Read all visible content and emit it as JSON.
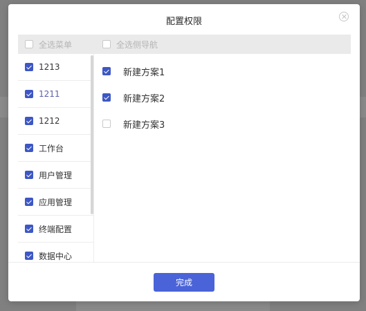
{
  "dialog": {
    "title": "配置权限",
    "close_icon": "close-circle-icon",
    "select_all_menu_label": "全选菜单",
    "select_all_menu_checked": false,
    "select_all_nav_label": "全选侧导航",
    "select_all_nav_checked": false,
    "menu_items": [
      {
        "label": "1213",
        "checked": true,
        "active": false
      },
      {
        "label": "1211",
        "checked": true,
        "active": true
      },
      {
        "label": "1212",
        "checked": true,
        "active": false
      },
      {
        "label": "工作台",
        "checked": true,
        "active": false
      },
      {
        "label": "用户管理",
        "checked": true,
        "active": false
      },
      {
        "label": "应用管理",
        "checked": true,
        "active": false
      },
      {
        "label": "终端配置",
        "checked": true,
        "active": false
      },
      {
        "label": "数据中心",
        "checked": true,
        "active": false
      }
    ],
    "nav_items": [
      {
        "label": "新建方案1",
        "checked": true
      },
      {
        "label": "新建方案2",
        "checked": true
      },
      {
        "label": "新建方案3",
        "checked": false
      }
    ],
    "done_button": "完成"
  },
  "colors": {
    "accent": "#4a63d8",
    "checkbox_checked": "#3d57c4",
    "active_text": "#5b5fa8",
    "header_bg": "#eaeaea",
    "overlay": "#808080"
  }
}
